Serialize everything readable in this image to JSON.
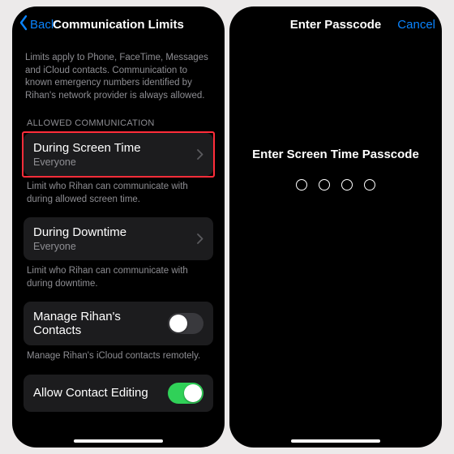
{
  "left": {
    "nav": {
      "back": "Back",
      "title": "Communication Limits"
    },
    "intro": "Limits apply to Phone, FaceTime, Messages and iCloud contacts. Communication to known emergency numbers identified by Rihan's network provider is always allowed.",
    "section_label": "ALLOWED COMMUNICATION",
    "rows": {
      "screen_time": {
        "title": "During Screen Time",
        "sub": "Everyone"
      },
      "screen_time_footer": "Limit who Rihan can communicate with during allowed screen time.",
      "downtime": {
        "title": "During Downtime",
        "sub": "Everyone"
      },
      "downtime_footer": "Limit who Rihan can communicate with during downtime.",
      "manage_contacts": {
        "title": "Manage Rihan's Contacts",
        "footer": "Manage Rihan's iCloud contacts remotely.",
        "on": false
      },
      "allow_edit": {
        "title": "Allow Contact Editing",
        "on": true
      }
    }
  },
  "right": {
    "nav": {
      "title": "Enter Passcode",
      "cancel": "Cancel"
    },
    "prompt": "Enter Screen Time Passcode",
    "digits": 4
  }
}
